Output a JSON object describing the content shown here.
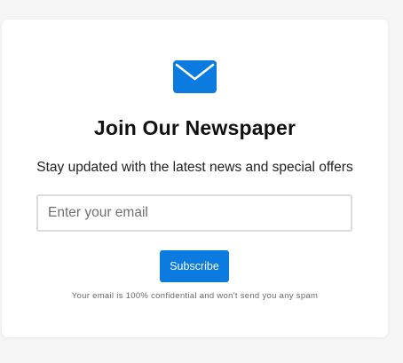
{
  "newsletter": {
    "icon": "envelope-icon",
    "title": "Join Our Newspaper",
    "subtitle": "Stay updated with the latest news and special offers",
    "email_placeholder": "Enter your email",
    "email_value": "",
    "subscribe_label": "Subscribe",
    "note": "Your email is 100% confidential and won't send you any spam"
  },
  "colors": {
    "accent": "#0b7be0",
    "background": "#f5f5f5",
    "card": "#ffffff"
  }
}
